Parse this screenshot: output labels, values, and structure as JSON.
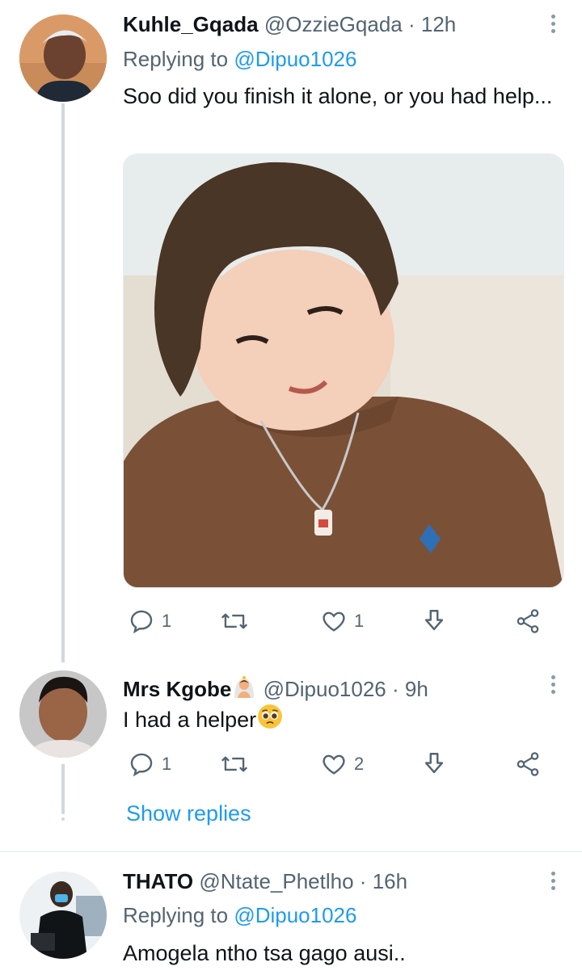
{
  "tweets": [
    {
      "name": "Kuhle_Gqada",
      "handle": "@OzzieGqada",
      "time": "12h",
      "replying_label": "Replying to",
      "replying_to": "@Dipuo1026",
      "text": "Soo did you finish it alone, or you had help...",
      "media": "photo of a smiling child in a brown sweater",
      "replies": "1",
      "retweets": "",
      "likes": "1"
    },
    {
      "name": "Mrs Kgobe",
      "handle": "@Dipuo1026",
      "time": "9h",
      "text": "I had a helper",
      "replies": "1",
      "retweets": "",
      "likes": "2"
    },
    {
      "name": "THATO",
      "handle": "@Ntate_Phetlho",
      "time": "16h",
      "replying_label": "Replying to",
      "replying_to": "@Dipuo1026",
      "text": "Amogela ntho tsa gago ausi.."
    }
  ],
  "show_replies_label": "Show replies",
  "colors": {
    "accent": "#1d9bf0",
    "secondary": "#536471",
    "thread_line": "#cfd9de"
  },
  "icons": [
    "reply-icon",
    "retweet-icon",
    "like-icon",
    "download-icon",
    "share-icon",
    "more-icon"
  ]
}
